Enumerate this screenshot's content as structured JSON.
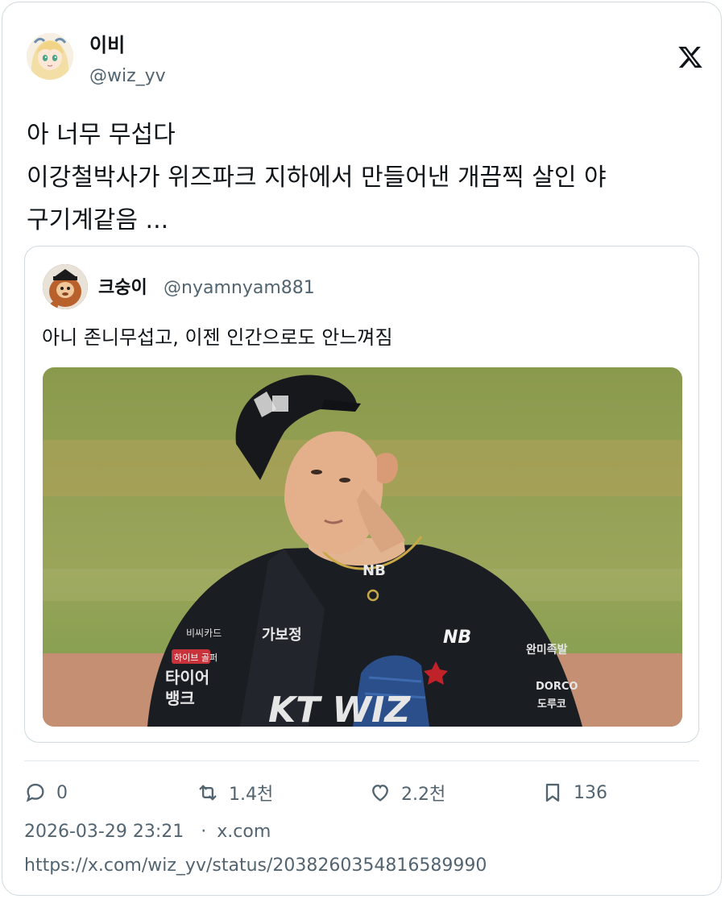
{
  "author": {
    "name": "이비",
    "handle": "@wiz_yv",
    "avatar_icon": "anime-avatar-icon"
  },
  "tweet": {
    "lines": [
      "아 너무 무섭다",
      "이강철박사가 위즈파크 지하에서 만들어낸 개끔찍 살인 야",
      "구기계같음 ..."
    ]
  },
  "quote": {
    "name": "크숭이",
    "handle": "@nyamnyam881",
    "avatar_icon": "orangutan-mascot-avatar-icon",
    "text": "아니 존니무섭고, 이젠 인간으로도 안느껴짐",
    "media": {
      "description_icon": "baseball-pitcher-photo",
      "cap_logo": "kt-cap-logo-icon",
      "chest_sponsor": "가보정",
      "chest_logo": "NB",
      "sleeve_left": [
        "비씨카드",
        "하이브 골퍼",
        "타이어",
        "뱅크"
      ],
      "sleeve_right": [
        "완미족발",
        "DORCO",
        "도루코"
      ],
      "team_text": "KT WIZ"
    }
  },
  "metrics": {
    "replies": "0",
    "retweets": "1.4천",
    "likes": "2.2천",
    "bookmarks": "136"
  },
  "meta": {
    "timestamp": "2026-03-29 23:21",
    "separator": "·",
    "source": "x.com"
  },
  "url": "https://x.com/wiz_yv/status/2038260354816589990",
  "colors": {
    "text": "#0f1419",
    "secondary": "#536471",
    "border": "#cfd9de"
  }
}
